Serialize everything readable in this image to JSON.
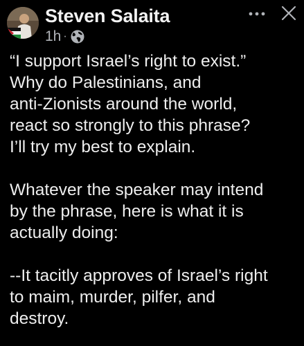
{
  "post": {
    "author": "Steven Salaita",
    "time": "1h",
    "separator": "·",
    "privacy_icon": "globe-icon",
    "more_icon": "more-options-icon",
    "close_icon": "close-icon",
    "paragraphs": [
      {
        "lines": [
          "“I support Israel’s right to exist.”",
          "Why do Palestinians, and",
          "anti-Zionists around the world,",
          "react so strongly to this phrase?",
          "I’ll try my best to explain."
        ]
      },
      {
        "lines": [
          "Whatever the speaker may intend",
          "by the phrase, here is what it is",
          "actually doing:"
        ]
      },
      {
        "lines": [
          "--It tacitly approves of Israel’s right",
          "to maim, murder, pilfer, and",
          "destroy."
        ]
      }
    ]
  },
  "colors": {
    "background": "#000000",
    "text": "#eeeeee",
    "secondary_text": "#b0b3b8"
  }
}
